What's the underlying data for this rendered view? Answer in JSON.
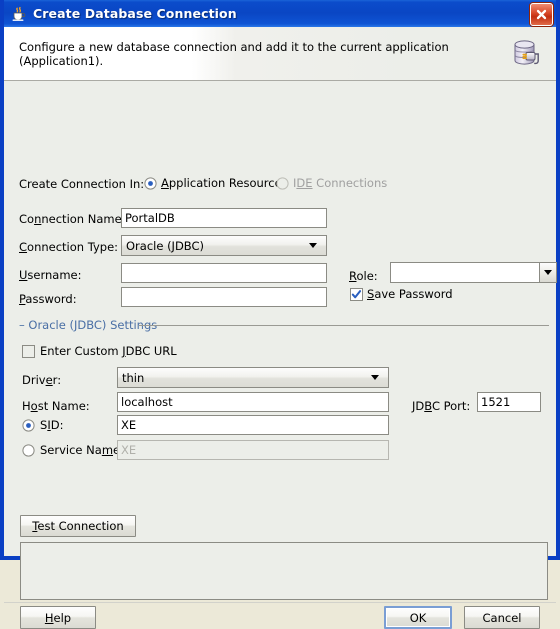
{
  "window": {
    "title": "Create Database Connection",
    "icon": "java-coffee-cup-icon",
    "close_label": "Close"
  },
  "header": {
    "description": "Configure a new database connection and add it to the current application (Application1).",
    "icon": "database-connection-icon"
  },
  "form": {
    "create_connection_in": {
      "label": "Create Connection In:",
      "options": [
        {
          "label": "Application Resources",
          "selected": true,
          "enabled": true,
          "mnemonic": "A"
        },
        {
          "label": "IDE Connections",
          "selected": false,
          "enabled": false,
          "mnemonic": "DE"
        }
      ]
    },
    "connection_name": {
      "label": "Connection Name:",
      "value": "PortalDB"
    },
    "connection_type": {
      "label": "Connection Type:",
      "value": "Oracle (JDBC)"
    },
    "username": {
      "label": "Username:",
      "value": ""
    },
    "password": {
      "label": "Password:",
      "value": ""
    },
    "role": {
      "label": "Role:",
      "value": ""
    },
    "save_password": {
      "label": "Save Password",
      "checked": true
    }
  },
  "settings_group": {
    "title": "Oracle (JDBC) Settings",
    "enter_custom_jdbc_url": {
      "label": "Enter Custom JDBC URL",
      "checked": false
    },
    "driver": {
      "label": "Driver:",
      "value": "thin"
    },
    "host_name": {
      "label": "Host Name:",
      "value": "localhost"
    },
    "jdbc_port": {
      "label": "JDBC Port:",
      "value": "1521"
    },
    "sid": {
      "label": "SID:",
      "value": "XE",
      "selected": true
    },
    "service_name": {
      "label": "Service Name:",
      "value": "XE",
      "selected": false,
      "enabled": false
    }
  },
  "actions": {
    "test_connection": "Test Connection",
    "help": "Help",
    "ok": "OK",
    "cancel": "Cancel"
  },
  "message_panel": {
    "text": ""
  },
  "colors": {
    "titlebar_blue": "#0a46c4",
    "dialog_border": "#0a3fc4",
    "face": "#eceee9",
    "group_label": "#4a6fa5",
    "close_red": "#c32f11",
    "accent_check": "#2a5fbf"
  }
}
